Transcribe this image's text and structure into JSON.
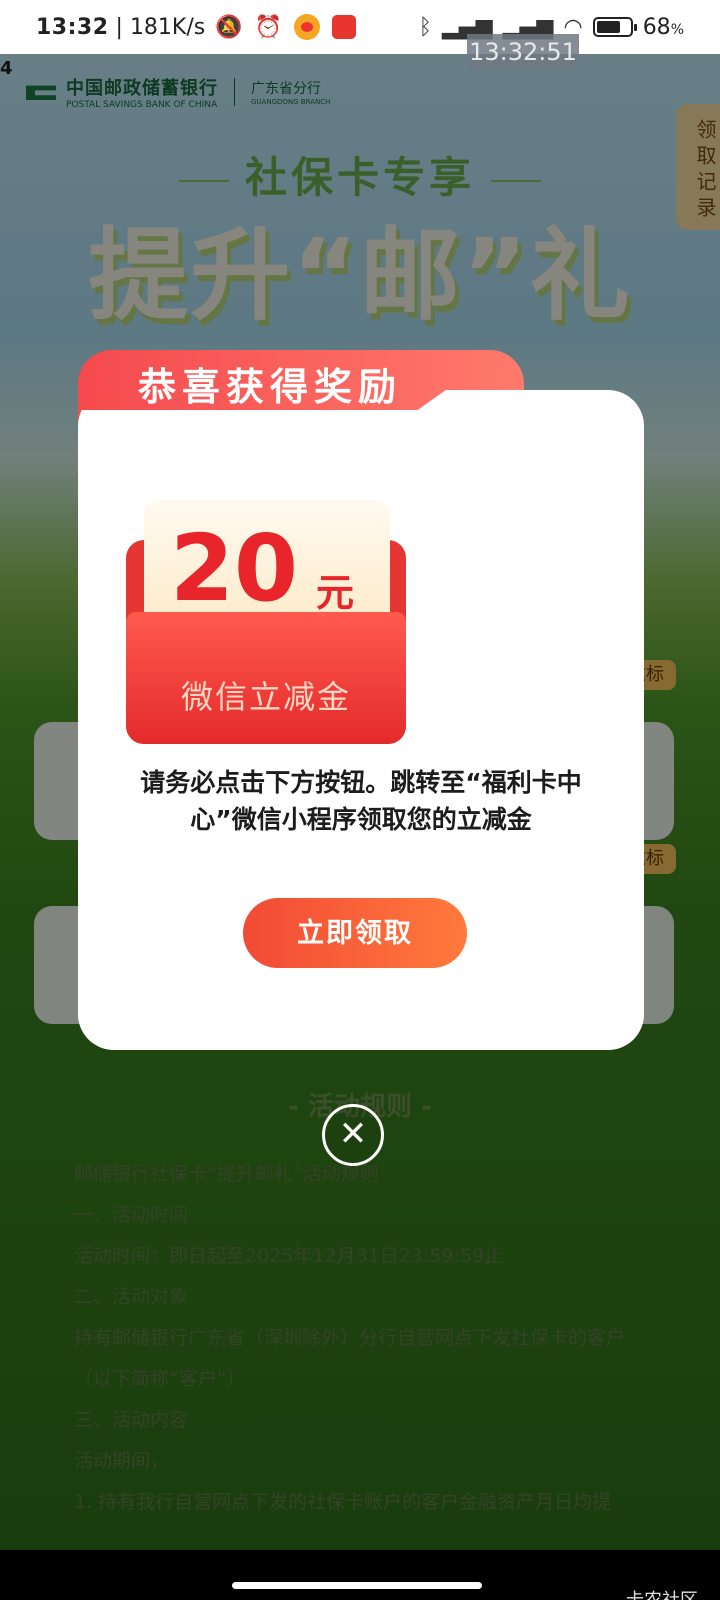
{
  "status_bar": {
    "time": "13:32",
    "network_speed": "181K/s",
    "battery_percent": "68",
    "battery_unit": "%",
    "icons": [
      "mute-bell-icon",
      "alarm-icon",
      "weibo-icon",
      "app-icon",
      "bluetooth-icon",
      "signal-icon",
      "signal-icon",
      "wifi-icon",
      "battery-icon"
    ]
  },
  "float_clock": "13:32:51",
  "edge_digit": "4",
  "brand": {
    "name_cn": "中国邮政储蓄银行",
    "name_en": "POSTAL SAVINGS BANK OF CHINA",
    "branch_cn": "广东省分行",
    "branch_en": "GUANGDONG BRANCH"
  },
  "side_record": "领取记录",
  "hero": {
    "subtitle": "社保卡专享",
    "title": "提升“邮”礼"
  },
  "background_tags": [
    "达标",
    "达标"
  ],
  "modal": {
    "tab_title": "恭喜获得奖励",
    "amount": "20",
    "unit": "元",
    "reward_label": "微信立减金",
    "message": "请务必点击下方按钮。跳转至“福利卡中心”微信小程序领取您的立减金",
    "claim_button": "立即领取",
    "close_symbol": "✕"
  },
  "rules": {
    "title": "- 活动规则 -",
    "lines": [
      "邮储银行社保卡“提升邮礼”活动规则",
      "一、活动时间",
      "活动时间：即日起至2025年12月31日23:59:59止",
      "二、活动对象",
      "持有邮储银行广东省（深圳除外）分行自营网点下发社保卡的客户",
      "（以下简称“客户”）",
      "三、活动内容",
      "活动期间，",
      "1. 持有我行自营网点下发的社保卡账户的客户金融资产月日均提"
    ]
  },
  "watermark": "卡农社区"
}
